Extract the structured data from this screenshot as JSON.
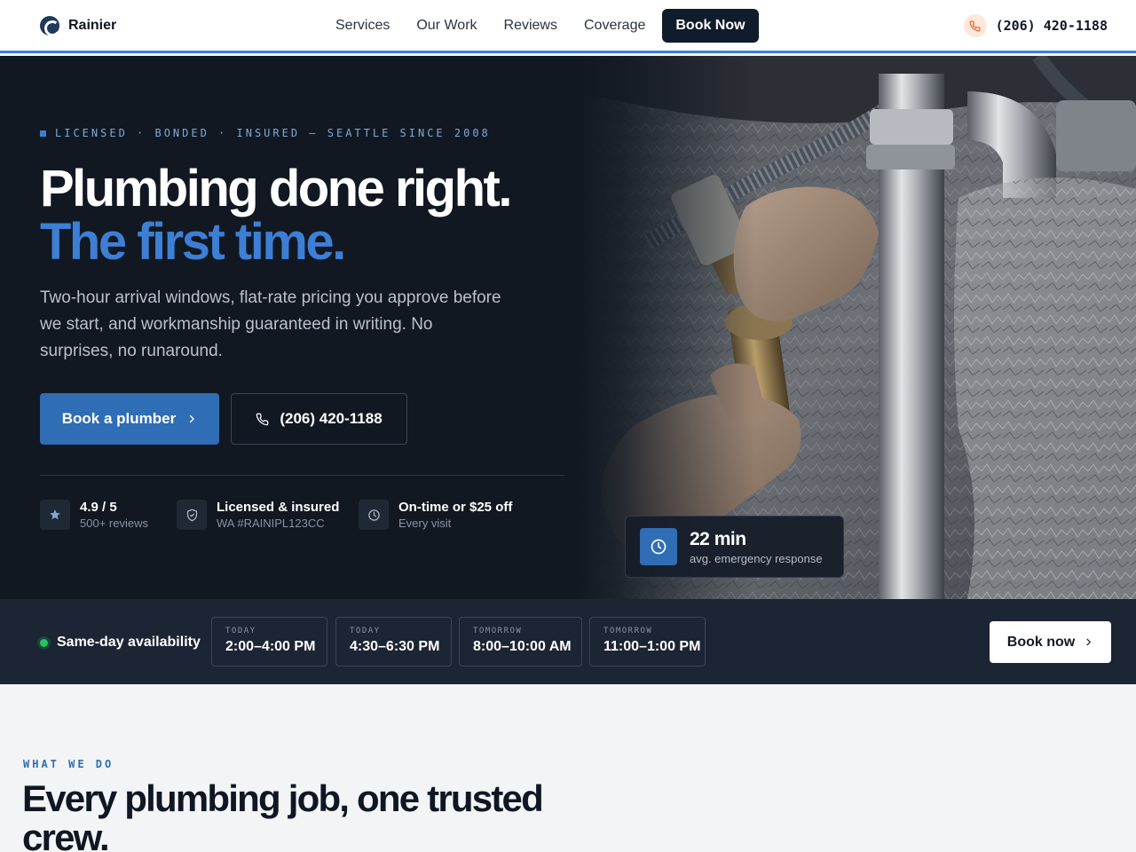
{
  "brand": {
    "name": "Rainier"
  },
  "nav": {
    "links": [
      "Services",
      "Our Work",
      "Reviews",
      "Coverage"
    ],
    "book_label": "Book Now",
    "phone": "(206) 420-1188"
  },
  "hero": {
    "eyebrow": "LICENSED · BONDED · INSURED — SEATTLE SINCE 2008",
    "headline_line1": "Plumbing done right.",
    "headline_line2": "The first time.",
    "lead": "Two-hour arrival windows, flat-rate pricing you approve before we start, and workmanship guaranteed in writing. No surprises, no runaround.",
    "primary_cta": "Book a plumber",
    "secondary_cta": "(206) 420-1188",
    "trust": [
      {
        "icon": "star-icon",
        "title": "4.9 / 5",
        "sub": "500+ reviews"
      },
      {
        "icon": "shield-check-icon",
        "title": "Licensed & insured",
        "sub": "WA #RAINIPL123CC"
      },
      {
        "icon": "clock-icon",
        "title": "On-time or $25 off",
        "sub": "Every visit"
      }
    ],
    "response": {
      "value": "22 min",
      "label": "avg. emergency response"
    }
  },
  "availability": {
    "label": "Same-day availability",
    "slots": [
      {
        "day": "TODAY",
        "time": "2:00–4:00 PM"
      },
      {
        "day": "TODAY",
        "time": "4:30–6:30 PM"
      },
      {
        "day": "TOMORROW",
        "time": "8:00–10:00 AM"
      },
      {
        "day": "TOMORROW",
        "time": "11:00–1:00 PM"
      }
    ],
    "book_label": "Book now"
  },
  "services": {
    "eyebrow": "WHAT WE DO",
    "title": "Every plumbing job, one trusted crew."
  },
  "colors": {
    "accent": "#2f6db5",
    "dark": "#111822",
    "band": "#1c2533",
    "success": "#22c55e"
  }
}
